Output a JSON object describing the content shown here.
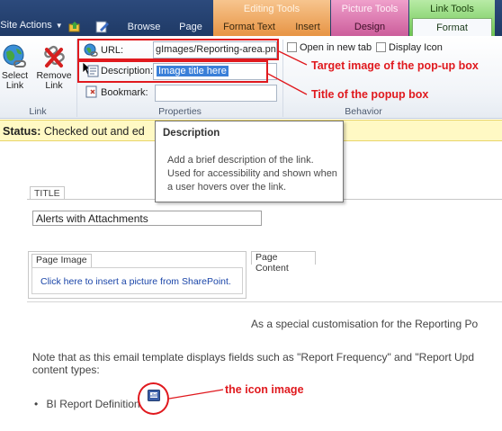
{
  "ribbon": {
    "tabs": {
      "site_actions": "Site Actions",
      "browse": "Browse",
      "page": "Page",
      "format_text": "Format Text",
      "insert": "Insert",
      "design": "Design",
      "format": "Format"
    },
    "context_groups": {
      "editing_tools": "Editing Tools",
      "picture_tools": "Picture Tools",
      "link_tools": "Link Tools"
    },
    "buttons": {
      "select_link": "Select\nLink",
      "remove_link": "Remove\nLink"
    },
    "fields": {
      "url_label": "URL:",
      "url_value": "gImages/Reporting-area.png",
      "description_label": "Description:",
      "description_value": "Image title here",
      "bookmark_label": "Bookmark:",
      "bookmark_value": ""
    },
    "checkboxes": {
      "open_new_tab": "Open in new tab",
      "display_icon": "Display Icon"
    },
    "group_labels": {
      "link": "Link",
      "properties": "Properties",
      "behavior": "Behavior"
    }
  },
  "status": {
    "label": "Status:",
    "text": "Checked out and ed"
  },
  "tooltip": {
    "title": "Description",
    "body": "Add a brief description of the link. Used for accessibility and shown when a user hovers over the link."
  },
  "annotations": {
    "target_image": "Target image of the pop-up box",
    "title_popup": "Title of the popup box",
    "icon_image": "the icon image"
  },
  "page": {
    "title_label": "TITLE",
    "title_value": "Alerts with Attachments",
    "page_image_tab": "Page Image",
    "insert_picture_link": "Click here to insert a picture from SharePoint.",
    "page_content_tab": "Page Content",
    "customisation_text": "As a special customisation for the Reporting Po",
    "note_text_line1": "Note that as this email template displays fields such as \"Report Frequency\" and \"Report Upd",
    "note_text_line2": "content types:",
    "bullet_item": "BI Report Definition"
  },
  "colors": {
    "annotation_red": "#e0191e",
    "status_yellow": "#fff9c4",
    "ribbon_blue": "#2c4a7c",
    "editing_tools_orange": "#f3b06c",
    "picture_tools_pink": "#e37fb6",
    "link_tools_green": "#8fd57a"
  }
}
